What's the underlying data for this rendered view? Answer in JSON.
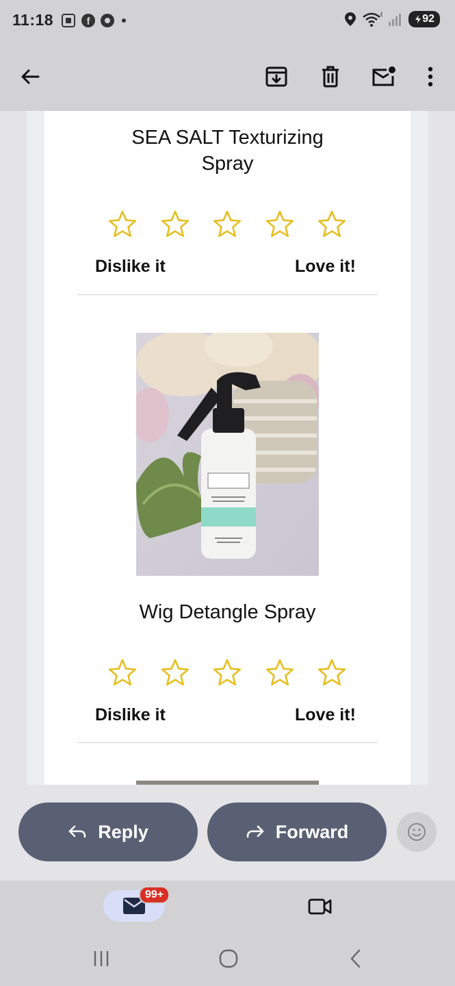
{
  "status_bar": {
    "time": "11:18",
    "battery": "92",
    "signal_label": "6",
    "icons": [
      "screen-capture-icon",
      "facebook-icon",
      "chrome-icon",
      "dot-icon",
      "location-icon",
      "wifi-icon",
      "signal-icon",
      "battery-icon"
    ]
  },
  "toolbar": {
    "icons": [
      "back-arrow-icon",
      "archive-icon",
      "trash-icon",
      "mark-unread-icon",
      "more-vert-icon"
    ]
  },
  "email": {
    "products": [
      {
        "title_line1": "SEA SALT Texturizing",
        "title_line2": "Spray",
        "dislike_label": "Dislike it",
        "love_label": "Love it!",
        "stars": 5
      },
      {
        "title_line1": "Wig Detangle Spray",
        "dislike_label": "Dislike it",
        "love_label": "Love it!",
        "stars": 5,
        "image": "spray-bottle-with-flowers"
      }
    ],
    "star_color": "#e6be1e"
  },
  "actions": {
    "reply_label": "Reply",
    "forward_label": "Forward",
    "pill_color": "#5a6074"
  },
  "bottom_nav": {
    "mail_badge": "99+",
    "badge_color": "#d93025"
  }
}
